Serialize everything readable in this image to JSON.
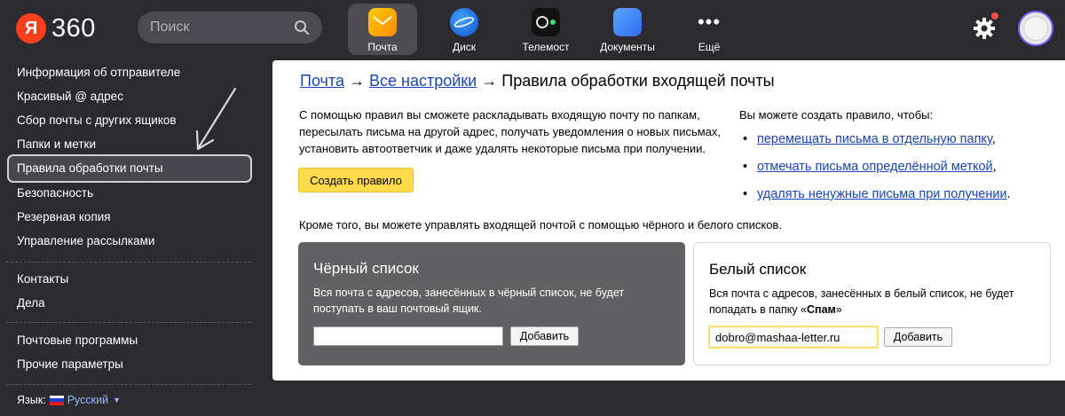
{
  "header": {
    "logo_letter": "Я",
    "logo_text": "360",
    "search_placeholder": "Поиск",
    "apps": [
      {
        "label": "Почта",
        "icon": "mail-icon",
        "active": true
      },
      {
        "label": "Диск",
        "icon": "disk-icon",
        "active": false
      },
      {
        "label": "Телемост",
        "icon": "telemost-icon",
        "active": false
      },
      {
        "label": "Документы",
        "icon": "docs-icon",
        "active": false
      },
      {
        "label": "Ещё",
        "icon": "more-icon",
        "active": false
      }
    ]
  },
  "sidebar": {
    "items": [
      "Информация об отправителе",
      "Красивый @ адрес",
      "Сбор почты с других ящиков",
      "Папки и метки",
      "Правила обработки почты",
      "Безопасность",
      "Резервная копия",
      "Управление рассылками",
      "Контакты",
      "Дела",
      "Почтовые программы",
      "Прочие параметры"
    ],
    "selected_index": 4,
    "language_label": "Язык:",
    "language_value": "Русский"
  },
  "main": {
    "breadcrumb": {
      "mail": "Почта",
      "sep1": "→",
      "all_settings": "Все настройки",
      "sep2": "→",
      "current": "Правила обработки входящей почты"
    },
    "intro": "С помощью правил вы сможете раскладывать входящую почту по папкам, пересылать письма на другой адрес, получать уведомления о новых письмах, установить автоответчик и даже удалять некоторые письма при получении.",
    "create_button": "Создать правило",
    "right_lead": "Вы можете создать правило, чтобы:",
    "rule_links": [
      "перемещать письма в отдельную папку",
      "отмечать письма определённой меткой",
      "удалять ненужные письма при получении"
    ],
    "rule_link_suffix": [
      ",",
      ",",
      "."
    ],
    "also_text": "Кроме того, вы можете управлять входящей почтой с помощью чёрного и белого списков.",
    "black_list": {
      "title": "Чёрный список",
      "desc": "Вся почта с адресов, занесённых в чёрный список, не будет поступать в ваш почтовый ящик.",
      "input_value": "",
      "add_button": "Добавить"
    },
    "white_list": {
      "title": "Белый список",
      "desc_before": "Вся почта с адресов, занесённых в белый список, не будет попадать в папку «",
      "desc_bold": "Спам",
      "desc_after": "»",
      "input_value": "dobro@mashaa-letter.ru",
      "add_button": "Добавить"
    }
  },
  "colors": {
    "background": "#2b2b2f",
    "accent_yellow": "#ffdb4d",
    "link": "#1a45b8",
    "logo_red": "#fc3f1d"
  }
}
